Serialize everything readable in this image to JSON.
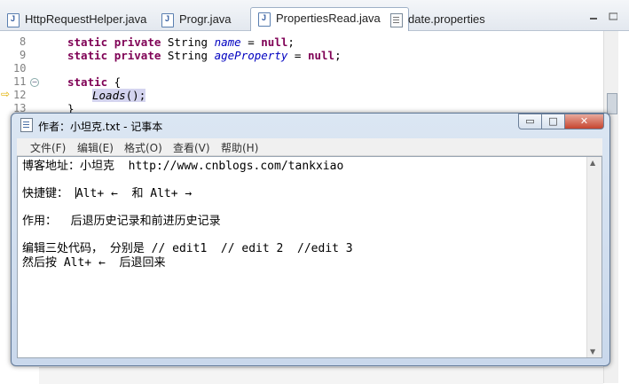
{
  "editor": {
    "tabs": [
      {
        "label": "HttpRequestHelper.java",
        "active": false
      },
      {
        "label": "Progr.java",
        "active": false
      },
      {
        "label": "PropertiesRead.java",
        "active": true,
        "close": "✕"
      },
      {
        "label": "date.properties",
        "active": false
      }
    ],
    "lines": [
      {
        "num": "8",
        "kw1": "static",
        "kw2": "private",
        "type": "String",
        "field": "name",
        "rest": " = ",
        "kw3": "null",
        "end": ";"
      },
      {
        "num": "9",
        "kw1": "static",
        "kw2": "private",
        "type": "String",
        "field": "ageProperty",
        "rest": " = ",
        "kw3": "null",
        "end": ";"
      },
      {
        "num": "10"
      },
      {
        "num": "11",
        "kw1": "static",
        "brace": " {"
      },
      {
        "num": "12",
        "method": "Loads",
        "call": "();"
      },
      {
        "num": "13",
        "brace": "}"
      }
    ]
  },
  "notepad": {
    "title": "作者：小坦克.txt - 记事本",
    "controls": {
      "minimize": "▭",
      "maximize": "□",
      "close": "✕"
    },
    "menu": [
      "文件(F)",
      "编辑(E)",
      "格式(O)",
      "查看(V)",
      "帮助(H)"
    ],
    "text": {
      "line1": "博客地址：小坦克  http://www.cnblogs.com/tankxiao",
      "line2_a": "快捷键：",
      "line2_b": "Alt+ ←  和 Alt+ →",
      "line3": "作用：  后退历史记录和前进历史记录",
      "line4": "编辑三处代码， 分别是 // edit1  // edit 2  //edit 3",
      "line5": "然后按 Alt+ ←  后退回来"
    }
  }
}
